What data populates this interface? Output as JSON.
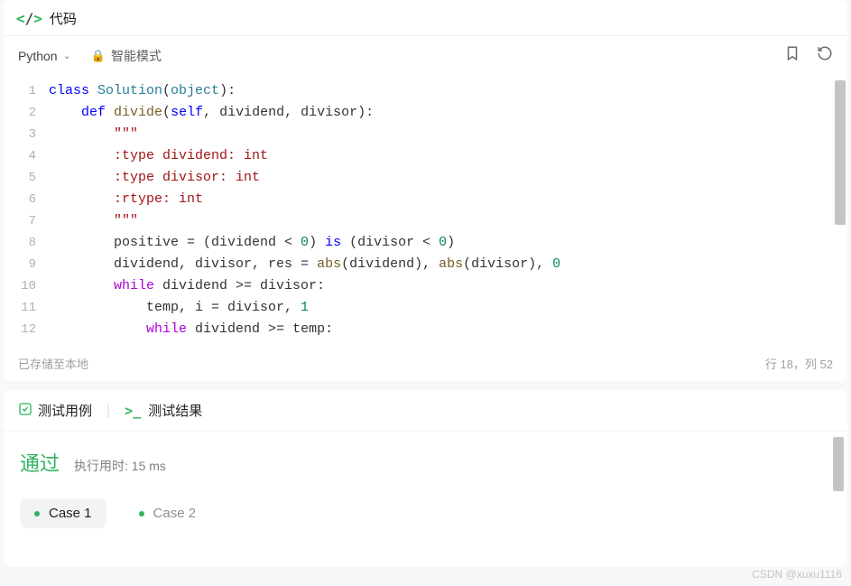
{
  "header": {
    "title": "代码"
  },
  "toolbar": {
    "language": "Python",
    "mode": "智能模式"
  },
  "code": {
    "lines": [
      [
        {
          "t": "class ",
          "c": "k-blue"
        },
        {
          "t": "Solution",
          "c": "k-teal"
        },
        {
          "t": "(",
          "c": "k-op"
        },
        {
          "t": "object",
          "c": "k-teal"
        },
        {
          "t": "):",
          "c": "k-op"
        }
      ],
      [
        {
          "t": "    ",
          "c": ""
        },
        {
          "t": "def ",
          "c": "k-blue"
        },
        {
          "t": "divide",
          "c": "k-fn"
        },
        {
          "t": "(",
          "c": "k-op"
        },
        {
          "t": "self",
          "c": "k-blue"
        },
        {
          "t": ", dividend, divisor):",
          "c": "k-op"
        }
      ],
      [
        {
          "t": "        ",
          "c": ""
        },
        {
          "t": "\"\"\"",
          "c": "k-red"
        }
      ],
      [
        {
          "t": "        ",
          "c": ""
        },
        {
          "t": ":type dividend: int",
          "c": "k-red"
        }
      ],
      [
        {
          "t": "        ",
          "c": ""
        },
        {
          "t": ":type divisor: int",
          "c": "k-red"
        }
      ],
      [
        {
          "t": "        ",
          "c": ""
        },
        {
          "t": ":rtype: int",
          "c": "k-red"
        }
      ],
      [
        {
          "t": "        ",
          "c": ""
        },
        {
          "t": "\"\"\"",
          "c": "k-red"
        }
      ],
      [
        {
          "t": "        positive = (dividend < ",
          "c": "k-op"
        },
        {
          "t": "0",
          "c": "k-num"
        },
        {
          "t": ") ",
          "c": "k-op"
        },
        {
          "t": "is",
          "c": "k-blue"
        },
        {
          "t": " (divisor < ",
          "c": "k-op"
        },
        {
          "t": "0",
          "c": "k-num"
        },
        {
          "t": ")",
          "c": "k-op"
        }
      ],
      [
        {
          "t": "        dividend, divisor, res = ",
          "c": "k-op"
        },
        {
          "t": "abs",
          "c": "k-fn"
        },
        {
          "t": "(dividend), ",
          "c": "k-op"
        },
        {
          "t": "abs",
          "c": "k-fn"
        },
        {
          "t": "(divisor), ",
          "c": "k-op"
        },
        {
          "t": "0",
          "c": "k-num"
        }
      ],
      [
        {
          "t": "        ",
          "c": ""
        },
        {
          "t": "while",
          "c": "k-purple"
        },
        {
          "t": " dividend >= divisor:",
          "c": "k-op"
        }
      ],
      [
        {
          "t": "            temp, i = divisor, ",
          "c": "k-op"
        },
        {
          "t": "1",
          "c": "k-num"
        }
      ],
      [
        {
          "t": "            ",
          "c": ""
        },
        {
          "t": "while",
          "c": "k-purple"
        },
        {
          "t": " dividend >= temp:",
          "c": "k-op"
        }
      ]
    ]
  },
  "status": {
    "left": "已存储至本地",
    "right": "行 18，列 52"
  },
  "tabs": {
    "testcase": "测试用例",
    "testresult": "测试结果"
  },
  "result": {
    "status": "通过",
    "runtime_label": "执行用时: 15 ms",
    "cases": [
      "Case 1",
      "Case 2"
    ]
  },
  "watermark": "CSDN @xuxu1116"
}
